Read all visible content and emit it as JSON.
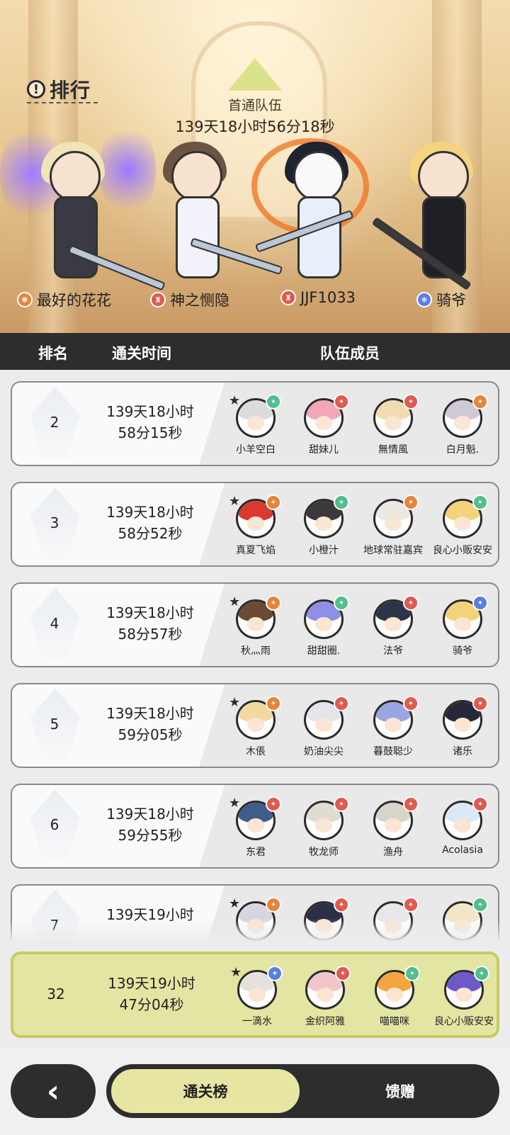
{
  "screen": {
    "title": "排行",
    "first_clear": {
      "label": "首通队伍",
      "time": "139天18小时56分18秒"
    }
  },
  "hero_team": [
    {
      "name": "最好的花花",
      "element_color": "#e8843a"
    },
    {
      "name": "神之恻隐",
      "element_color": "#e05a4f"
    },
    {
      "name": "JJF1033",
      "element_color": "#e05a4f"
    },
    {
      "name": "骑爷",
      "element_color": "#5a7fe0"
    }
  ],
  "table": {
    "headers": {
      "rank": "排名",
      "time": "通关时间",
      "members": "队伍成员"
    },
    "rows": [
      {
        "rank": "2",
        "time_line1": "139天18小时",
        "time_line2": "58分15秒",
        "members": [
          {
            "name": "小羊空白",
            "badge": "#4fbf8c",
            "hair": "#dcdcdc"
          },
          {
            "name": "甜妹儿",
            "badge": "#e05a4f",
            "hair": "#f2a6b8"
          },
          {
            "name": "無情風",
            "badge": "#e05a4f",
            "hair": "#f0dcb0"
          },
          {
            "name": "白月魁.",
            "badge": "#e8843a",
            "hair": "#cfc9d6"
          }
        ]
      },
      {
        "rank": "3",
        "time_line1": "139天18小时",
        "time_line2": "58分52秒",
        "members": [
          {
            "name": "真夏飞焰",
            "badge": "#e8843a",
            "hair": "#d83a2e"
          },
          {
            "name": "小橙汁",
            "badge": "#4fbf8c",
            "hair": "#3a3a3a"
          },
          {
            "name": "地球常驻嘉宾",
            "badge": "#e8843a",
            "hair": "#ece9e2"
          },
          {
            "name": "良心小贩安安",
            "badge": "#4fbf8c",
            "hair": "#f2d37a"
          }
        ]
      },
      {
        "rank": "4",
        "time_line1": "139天18小时",
        "time_line2": "58分57秒",
        "members": [
          {
            "name": "秋灬雨",
            "badge": "#e8843a",
            "hair": "#6b4a36"
          },
          {
            "name": "甜甜圈.",
            "badge": "#4fbf8c",
            "hair": "#8f8fe6"
          },
          {
            "name": "法爷",
            "badge": "#e05a4f",
            "hair": "#2d3448"
          },
          {
            "name": "骑爷",
            "badge": "#5a7fe0",
            "hair": "#f2d37a"
          }
        ]
      },
      {
        "rank": "5",
        "time_line1": "139天18小时",
        "time_line2": "59分05秒",
        "members": [
          {
            "name": "木倀",
            "badge": "#e8843a",
            "hair": "#f2d9a0"
          },
          {
            "name": "奶油尖尖",
            "badge": "#e05a4f",
            "hair": "#e4e4ec"
          },
          {
            "name": "暮鼓聪少",
            "badge": "#e05a4f",
            "hair": "#9aa6e2"
          },
          {
            "name": "诸乐",
            "badge": "#e05a4f",
            "hair": "#26283a"
          }
        ]
      },
      {
        "rank": "6",
        "time_line1": "139天18小时",
        "time_line2": "59分55秒",
        "members": [
          {
            "name": "东君",
            "badge": "#e05a4f",
            "hair": "#3f5d88"
          },
          {
            "name": "牧龙师",
            "badge": "#e05a4f",
            "hair": "#e0dcd2"
          },
          {
            "name": "渔舟",
            "badge": "#e05a4f",
            "hair": "#d8d4c8"
          },
          {
            "name": "Acolasia",
            "badge": "#e05a4f",
            "hair": "#dbe8f6"
          }
        ]
      },
      {
        "rank": "7",
        "time_line1": "139天19小时",
        "time_line2": "",
        "members": [
          {
            "name": "",
            "badge": "#e8843a",
            "hair": "#d8d4e2"
          },
          {
            "name": "",
            "badge": "#e05a4f",
            "hair": "#2a3048"
          },
          {
            "name": "",
            "badge": "#e05a4f",
            "hair": "#e8e8ec"
          },
          {
            "name": "",
            "badge": "#4fbf8c",
            "hair": "#f2e6c6"
          }
        ]
      }
    ]
  },
  "own_row": {
    "rank": "32",
    "time_line1": "139天19小时",
    "time_line2": "47分04秒",
    "members": [
      {
        "name": "一滴水",
        "badge": "#5a7fe0",
        "hair": "#e4e2dc"
      },
      {
        "name": "金织阿雅",
        "badge": "#e05a4f",
        "hair": "#f0c6cc"
      },
      {
        "name": "喵喵咪",
        "badge": "#4fbf8c",
        "hair": "#f2a640"
      },
      {
        "name": "良心小贩安安",
        "badge": "#4fbf8c",
        "hair": "#6d5ac6"
      }
    ]
  },
  "footer": {
    "back_icon": "chevron-left-icon",
    "back_glyph": "‹",
    "tab_active": "通关榜",
    "tab_inactive": "馈赠"
  },
  "colors": {
    "accent": "#e6e6a2",
    "dark": "#2d2d2d"
  }
}
